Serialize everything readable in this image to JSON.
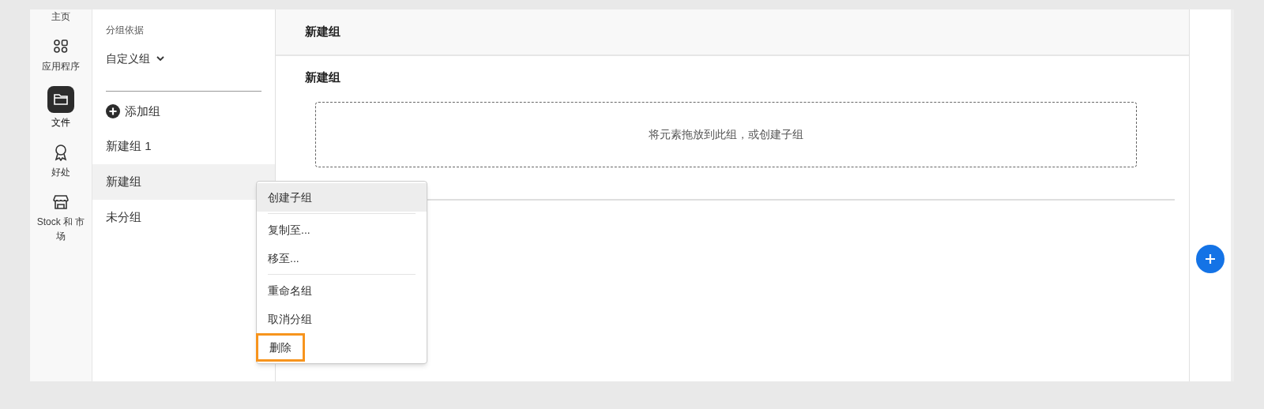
{
  "nav": [
    {
      "label": "主页",
      "selected": false
    },
    {
      "label": "应用程序",
      "selected": false
    },
    {
      "label": "文件",
      "selected": true
    },
    {
      "label": "好处",
      "selected": false
    },
    {
      "label": "Stock 和 市场",
      "selected": false
    }
  ],
  "groups_panel": {
    "group_by_label": "分组依据",
    "group_by": "自定义组",
    "add_group": "添加组",
    "groups": [
      {
        "label": "新建组 1",
        "selected": false
      },
      {
        "label": "新建组",
        "selected": true
      },
      {
        "label": "未分组",
        "selected": false
      }
    ]
  },
  "main": {
    "header": "新建组",
    "section_title": "新建组",
    "drop_zone": "将元素拖放到此组，或创建子组"
  },
  "context_menu": {
    "sections": [
      [
        {
          "label": "创建子组",
          "hovered": true,
          "marked": false
        }
      ],
      [
        {
          "label": "复制至...",
          "hovered": false,
          "marked": false
        },
        {
          "label": "移至...",
          "hovered": false,
          "marked": false
        }
      ],
      [
        {
          "label": "重命名组",
          "hovered": false,
          "marked": false
        },
        {
          "label": "取消分组",
          "hovered": false,
          "marked": false
        },
        {
          "label": "删除",
          "hovered": false,
          "marked": true
        }
      ]
    ]
  }
}
